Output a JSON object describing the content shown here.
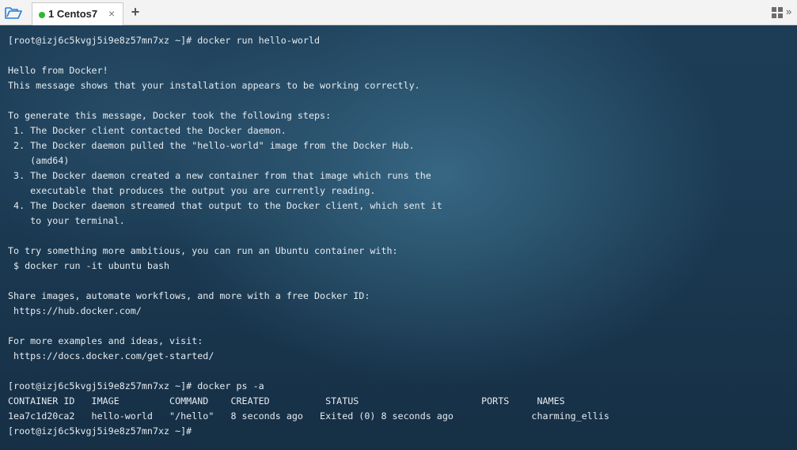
{
  "tabbar": {
    "session_tab": {
      "label": "1 Centos7",
      "status_color": "#2fb82f",
      "close_glyph": "×"
    },
    "add_tab_glyph": "+",
    "folder_icon": "folder-open-icon",
    "layout_icon": "grid-icon",
    "more_glyph": "»"
  },
  "terminal": {
    "lines": [
      "[root@izj6c5kvgj5i9e8z57mn7xz ~]# docker run hello-world",
      "",
      "Hello from Docker!",
      "This message shows that your installation appears to be working correctly.",
      "",
      "To generate this message, Docker took the following steps:",
      " 1. The Docker client contacted the Docker daemon.",
      " 2. The Docker daemon pulled the \"hello-world\" image from the Docker Hub.",
      "    (amd64)",
      " 3. The Docker daemon created a new container from that image which runs the",
      "    executable that produces the output you are currently reading.",
      " 4. The Docker daemon streamed that output to the Docker client, which sent it",
      "    to your terminal.",
      "",
      "To try something more ambitious, you can run an Ubuntu container with:",
      " $ docker run -it ubuntu bash",
      "",
      "Share images, automate workflows, and more with a free Docker ID:",
      " https://hub.docker.com/",
      "",
      "For more examples and ideas, visit:",
      " https://docs.docker.com/get-started/",
      "",
      "[root@izj6c5kvgj5i9e8z57mn7xz ~]# docker ps -a",
      "CONTAINER ID   IMAGE         COMMAND    CREATED          STATUS                      PORTS     NAMES",
      "1ea7c1d20ca2   hello-world   \"/hello\"   8 seconds ago   Exited (0) 8 seconds ago              charming_ellis",
      "[root@izj6c5kvgj5i9e8z57mn7xz ~]#"
    ]
  }
}
